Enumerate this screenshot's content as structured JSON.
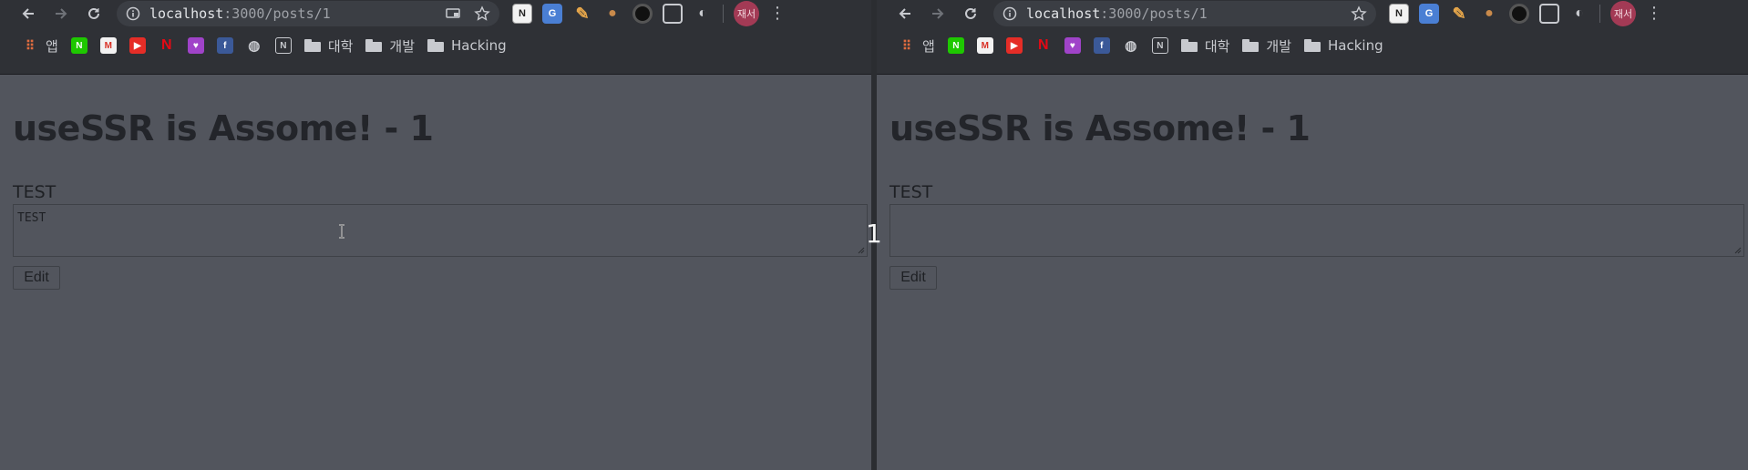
{
  "windows": [
    {
      "url_host": "localhost",
      "url_path": ":3000/posts/1",
      "bookmarks": [
        "앱",
        "대학",
        "개발",
        "Hacking"
      ],
      "avatar_text": "재서",
      "title": "useSSR is Assome! - 1",
      "field_label": "TEST",
      "textarea_value": "TEST",
      "edit_label": "Edit"
    },
    {
      "url_host": "localhost",
      "url_path": ":3000/posts/1",
      "bookmarks": [
        "앱",
        "대학",
        "개발",
        "Hacking"
      ],
      "avatar_text": "재서",
      "title": "useSSR is Assome! - 1",
      "field_label": "TEST",
      "textarea_value": "",
      "edit_label": "Edit"
    }
  ],
  "counter": "1",
  "colors": {
    "page_bg": "#52555d",
    "chrome_bg": "#2f3136",
    "omnibox_bg": "#3b3e44",
    "title_text": "#23252a"
  },
  "icons": [
    "back-icon",
    "forward-icon",
    "reload-icon",
    "info-icon",
    "cast-icon",
    "star-icon",
    "folder-icon",
    "menu-icon"
  ]
}
